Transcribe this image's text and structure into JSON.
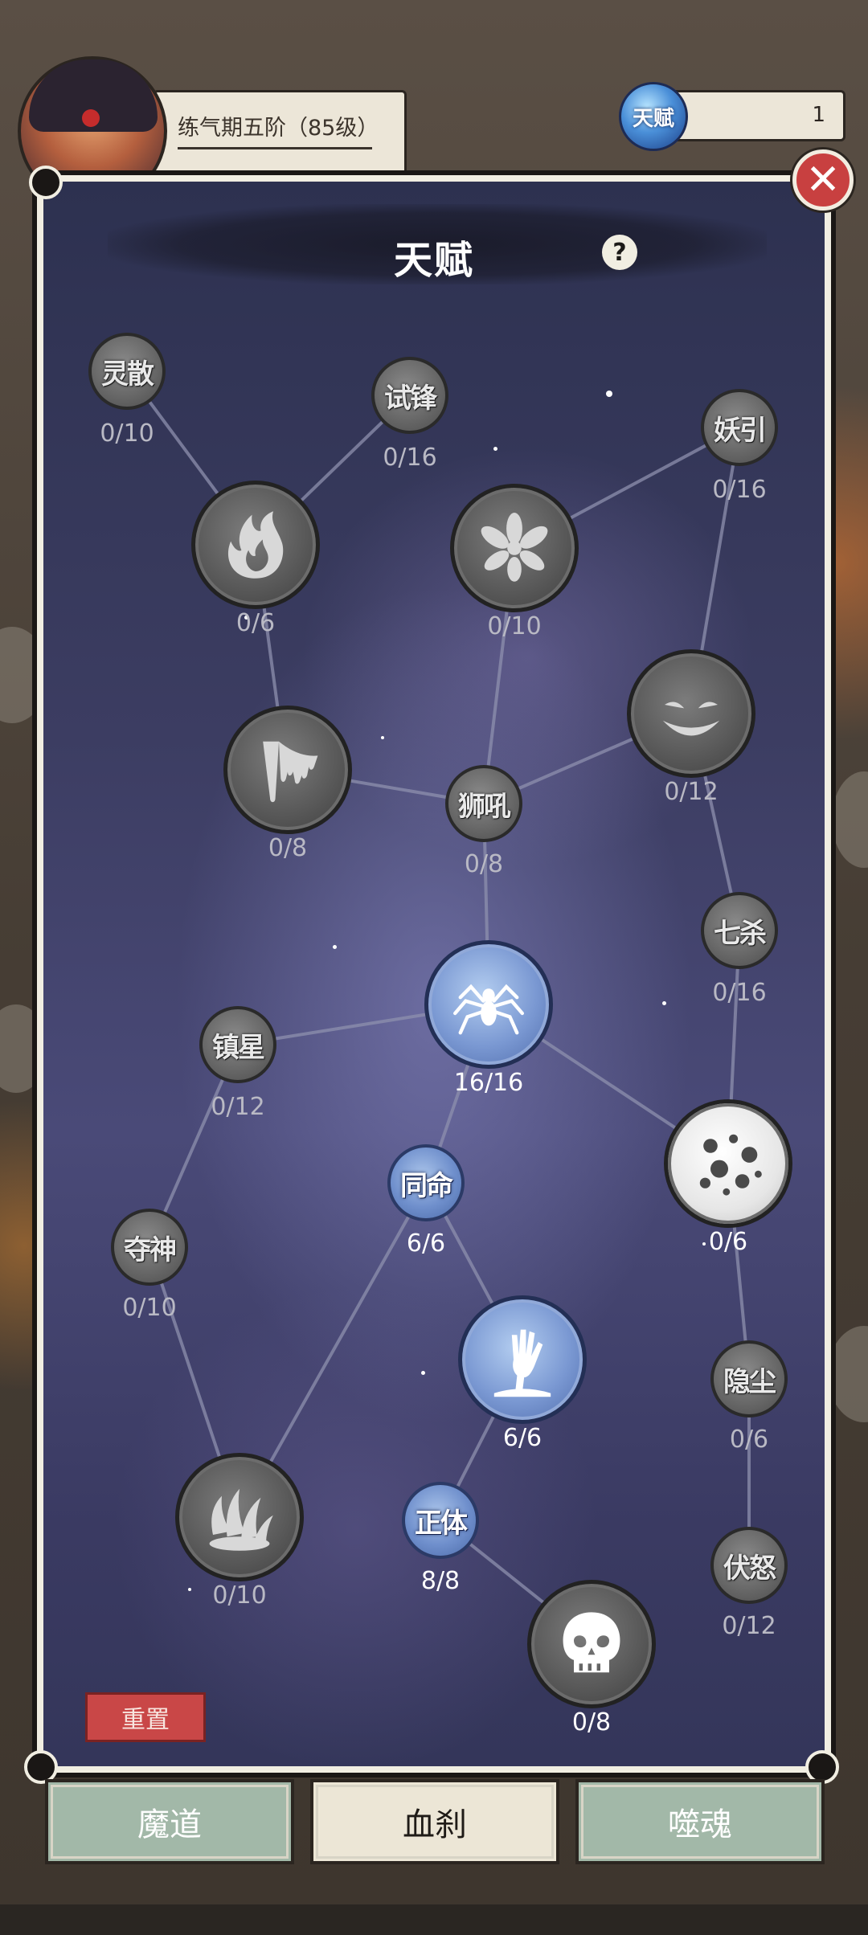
{
  "hud": {
    "level_text": "练气期五阶（85级）",
    "talent_icon_label": "天赋",
    "talent_points": "1"
  },
  "modal": {
    "title": "天赋",
    "help_symbol": "?",
    "close_symbol": "✕",
    "reset_label": "重置"
  },
  "nodes": [
    {
      "id": "lingsan",
      "char": "灵散",
      "progress": "0/10",
      "active": false,
      "kind": "small"
    },
    {
      "id": "shifeng",
      "char": "试锋",
      "progress": "0/16",
      "active": false,
      "kind": "small"
    },
    {
      "id": "yaoyin",
      "char": "妖引",
      "progress": "0/16",
      "active": false,
      "kind": "small"
    },
    {
      "id": "flame",
      "icon": "flame-icon",
      "progress": "0/6",
      "active": false,
      "kind": "large"
    },
    {
      "id": "burst",
      "icon": "burst-icon",
      "progress": "0/10",
      "active": false,
      "kind": "large"
    },
    {
      "id": "grin",
      "icon": "grin-face-icon",
      "progress": "0/12",
      "active": false,
      "kind": "large"
    },
    {
      "id": "drip",
      "icon": "drip-icon",
      "progress": "0/8",
      "active": false,
      "kind": "large"
    },
    {
      "id": "shihou",
      "char": "狮吼",
      "progress": "0/8",
      "active": false,
      "kind": "small"
    },
    {
      "id": "qisha",
      "char": "七杀",
      "progress": "0/16",
      "active": false,
      "kind": "small"
    },
    {
      "id": "spider",
      "icon": "spider-icon",
      "progress": "16/16",
      "active": true,
      "kind": "large"
    },
    {
      "id": "zhenxing",
      "char": "镇星",
      "progress": "0/12",
      "active": false,
      "kind": "small"
    },
    {
      "id": "moon",
      "icon": "moon-icon",
      "progress": "0/6",
      "active": false,
      "kind": "large"
    },
    {
      "id": "tongming",
      "char": "同命",
      "progress": "6/6",
      "active": true,
      "kind": "small"
    },
    {
      "id": "duoshen",
      "char": "夺神",
      "progress": "0/10",
      "active": false,
      "kind": "small"
    },
    {
      "id": "hand",
      "icon": "rising-hand-icon",
      "progress": "6/6",
      "active": true,
      "kind": "large"
    },
    {
      "id": "yinchen",
      "char": "隐尘",
      "progress": "0/6",
      "active": false,
      "kind": "small"
    },
    {
      "id": "claws",
      "icon": "claws-icon",
      "progress": "0/10",
      "active": false,
      "kind": "large"
    },
    {
      "id": "zhengti",
      "char": "正体",
      "progress": "8/8",
      "active": true,
      "kind": "small"
    },
    {
      "id": "funu",
      "char": "伏怒",
      "progress": "0/12",
      "active": false,
      "kind": "small"
    },
    {
      "id": "skull",
      "icon": "skull-icon",
      "progress": "0/8",
      "active": false,
      "kind": "large"
    }
  ],
  "tabs": [
    {
      "label": "魔道",
      "selected": false
    },
    {
      "label": "血刹",
      "selected": true
    },
    {
      "label": "噬魂",
      "selected": false
    }
  ],
  "colors": {
    "active_node": "#7a98d2",
    "inactive_node": "#5a5a5a",
    "close_button": "#c84040",
    "reset_button": "#c94747",
    "tab_selected": "#ece6d6",
    "tab_unselected": "#a2b8a8"
  }
}
